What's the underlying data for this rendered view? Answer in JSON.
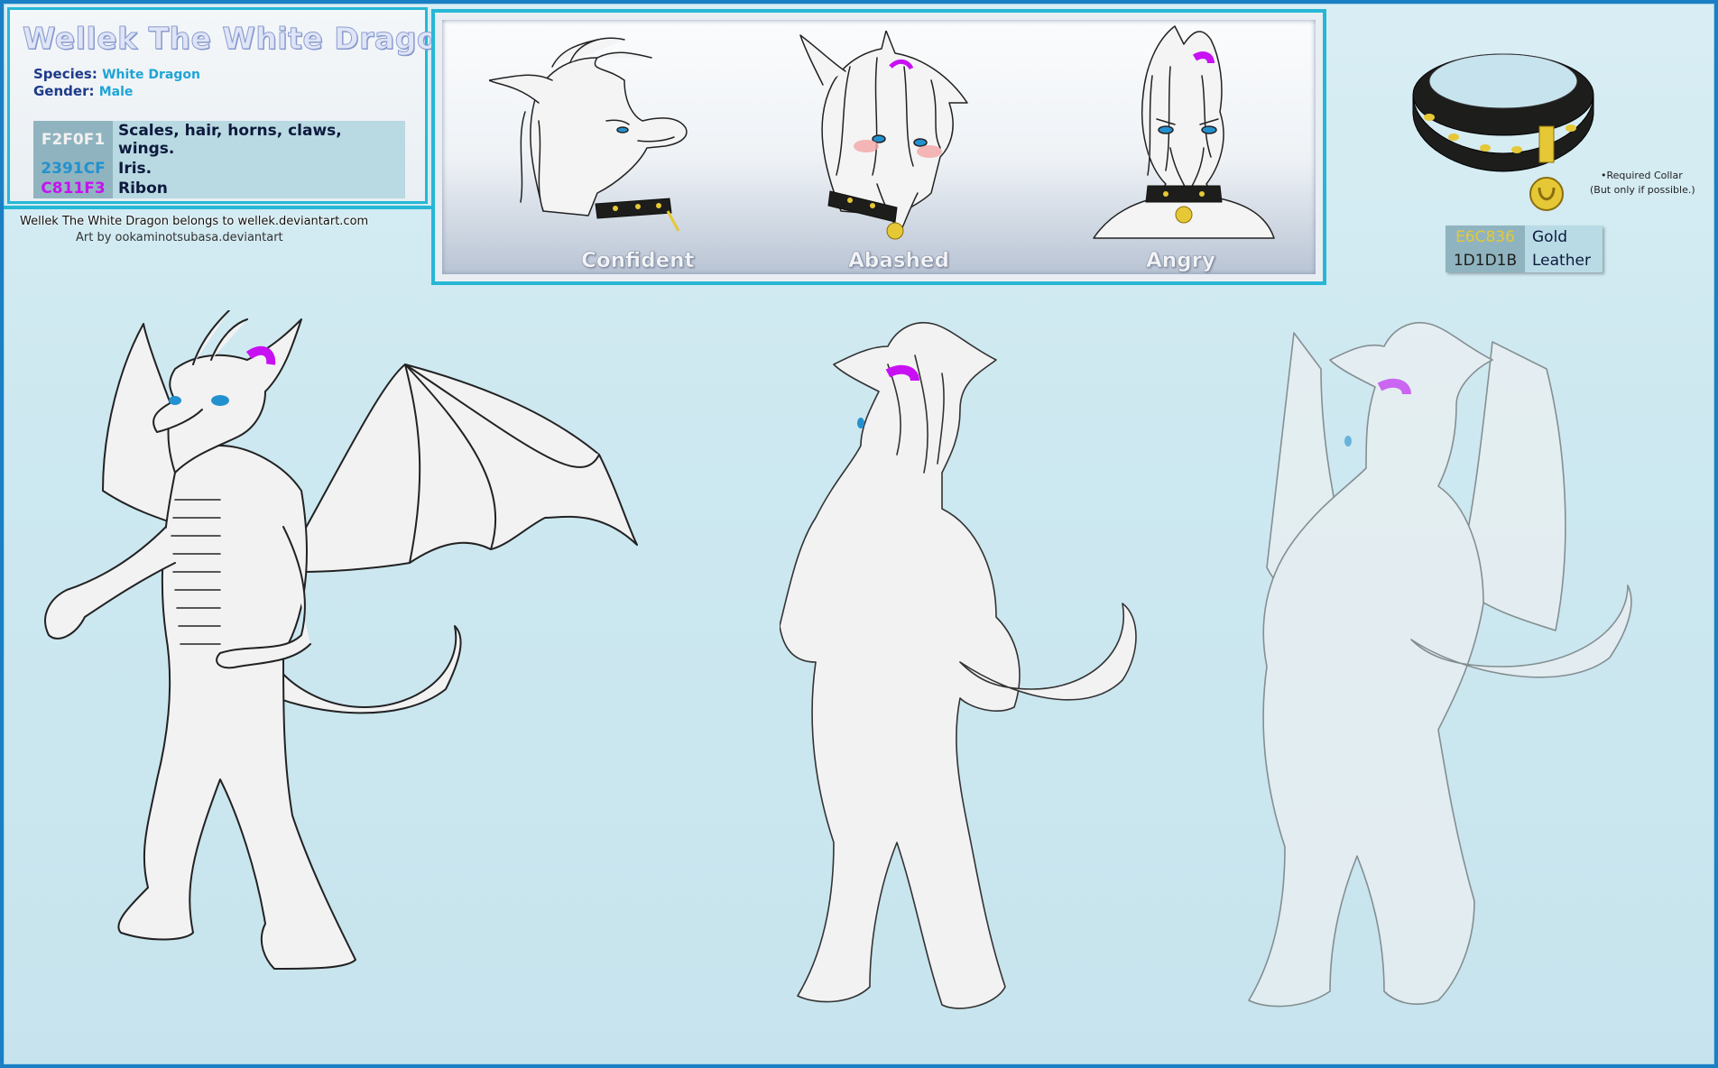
{
  "info": {
    "title": "Wellek The White Dragon",
    "species_label": "Species:",
    "species_value": "White Dragon",
    "gender_label": "Gender:",
    "gender_value": "Male",
    "colors": [
      {
        "code": "F2F0F1",
        "description": "Scales, hair, horns, claws, wings.",
        "color": "#F2F0F1"
      },
      {
        "code": "2391CF",
        "description": "Iris.",
        "color": "#2391CF"
      },
      {
        "code": "C811F3",
        "description": "Ribon",
        "color": "#C811F3"
      }
    ]
  },
  "credits": {
    "owner": "Wellek The White Dragon belongs to wellek.deviantart.com",
    "artist": "Art by ookaminotsubasa.deviantart"
  },
  "expressions": [
    "Confident",
    "Abashed",
    "Angry"
  ],
  "collar": {
    "note_line1": "•Required Collar",
    "note_line2": "(But only if possible.)",
    "colors": [
      {
        "code": "E6C836",
        "description": "Gold",
        "color": "#E6C836"
      },
      {
        "code": "1D1D1B",
        "description": "Leather",
        "color": "#1D1D1B"
      }
    ]
  },
  "views": [
    "front-view",
    "back-view",
    "side-back-view"
  ]
}
